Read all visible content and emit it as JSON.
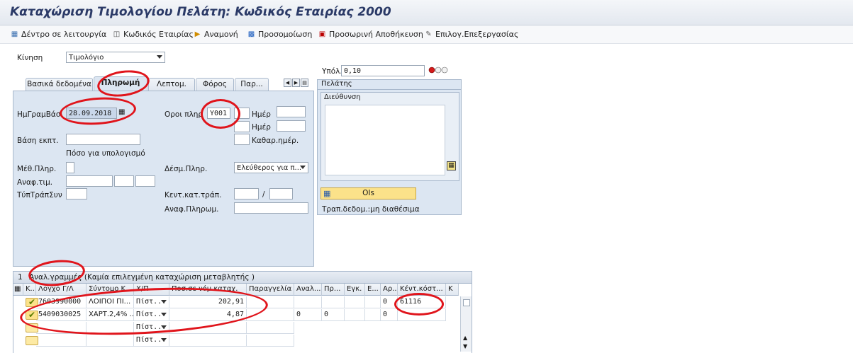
{
  "window": {
    "title": "Καταχώριση Τιμολογίου Πελάτη: Κωδικός Εταιρίας 2000"
  },
  "toolbar": {
    "items": [
      {
        "label": "Δέντρο σε λειτουργία",
        "icon": "tree-icon"
      },
      {
        "label": "Κωδικός Εταιρίας",
        "icon": "company-code-icon"
      },
      {
        "label": "Αναμονή",
        "icon": "hold-icon"
      },
      {
        "label": "Προσομοίωση",
        "icon": "simulate-icon"
      },
      {
        "label": "Προσωρινή Αποθήκευση",
        "icon": "save-icon"
      },
      {
        "label": "Επιλογ.Επεξεργασίας",
        "icon": "pencil-icon"
      }
    ]
  },
  "header": {
    "movement_label": "Κίνηση",
    "movement_value": "Τιμολόγιο",
    "balance_label": "Υπόλ.",
    "balance_value": "0,10"
  },
  "tabs": [
    {
      "label": "Βασικά δεδομένα",
      "active": false
    },
    {
      "label": "Πληρωμή",
      "active": true
    },
    {
      "label": "Λεπτομ.",
      "active": false
    },
    {
      "label": "Φόρος",
      "active": false
    },
    {
      "label": "Παρ...",
      "active": false
    }
  ],
  "payment": {
    "baseline_date_label": "ΗμΓραμΒάσ.",
    "baseline_date_value": "28.09.2018",
    "terms_label": "Οροι πληρ",
    "terms_value": "Y001",
    "days_label_1": "Ημέρ",
    "days_label_2": "Ημέρ",
    "net_days_label": "Καθαρ.ημέρ.",
    "discount_base_label": "Βάση εκπτ.",
    "calc_amount_label": "Πόσο για υπολογισμό",
    "pay_method_label": "Μέθ.Πληρ.",
    "pay_block_label": "Δέσμ.Πληρ.",
    "pay_block_value": "Ελεύθερος για π...",
    "ref_label": "Αναφ.τιμ.",
    "bank_type_label": "ΤύπΤράπΣυν",
    "house_bank_label": "Κεντ.κατ.τράπ.",
    "pay_ref_label": "Αναφ.Πληρωμ.",
    "slash": "/"
  },
  "customer": {
    "header": "Πελάτης",
    "address_label": "Διεύθυνση",
    "ois_button": "OIs",
    "bank_status": "Τραπ.δεδομ.:μη διαθέσιμα"
  },
  "grid": {
    "title": "Αναλ.γραμμές (Καμία επιλεγμένη καταχώριση μεταβλητής )",
    "title_prefix": "1",
    "columns": [
      "Κ...",
      "Λογχο Γ/Λ",
      "Σύντομο Κ...",
      "Χ/Π",
      "Ποσ.σε νόμ.καταχ.",
      "Παραγγελία",
      "Αναλ...",
      "Πρ...",
      "Εγκ.",
      "Ε...",
      "Αρ...",
      "Κέντ.κόστ...",
      "Κ"
    ],
    "rows": [
      {
        "status": "ok",
        "gl": "7603990000",
        "short": "ΛΟΙΠΟΙ ΠΙ...",
        "dc": "Πίστ...",
        "amount": "202,91",
        "order": "",
        "c6": "",
        "c7": "",
        "c8": "",
        "c9": "",
        "c10": "0",
        "cost_center": "61116"
      },
      {
        "status": "ok",
        "gl": "5409030025",
        "short": "ΧΑΡΤ.2,4% ...",
        "dc": "Πίστ...",
        "amount": "4,87",
        "order": "",
        "c6": "0",
        "c7": "0",
        "c8": "",
        "c9": "",
        "c10": "0",
        "cost_center": ""
      },
      {
        "status": "empty",
        "gl": "",
        "short": "",
        "dc": "Πίστ...",
        "amount": "",
        "order": "",
        "c6": "",
        "c7": "",
        "c8": "",
        "c9": "",
        "c10": "",
        "cost_center": ""
      },
      {
        "status": "empty",
        "gl": "",
        "short": "",
        "dc": "Πίστ...",
        "amount": "",
        "order": "",
        "c6": "",
        "c7": "",
        "c8": "",
        "c9": "",
        "c10": "",
        "cost_center": ""
      }
    ]
  },
  "colors": {
    "title": "#2b3a67",
    "panel": "#dce6f2",
    "annotation": "#e0141b"
  }
}
